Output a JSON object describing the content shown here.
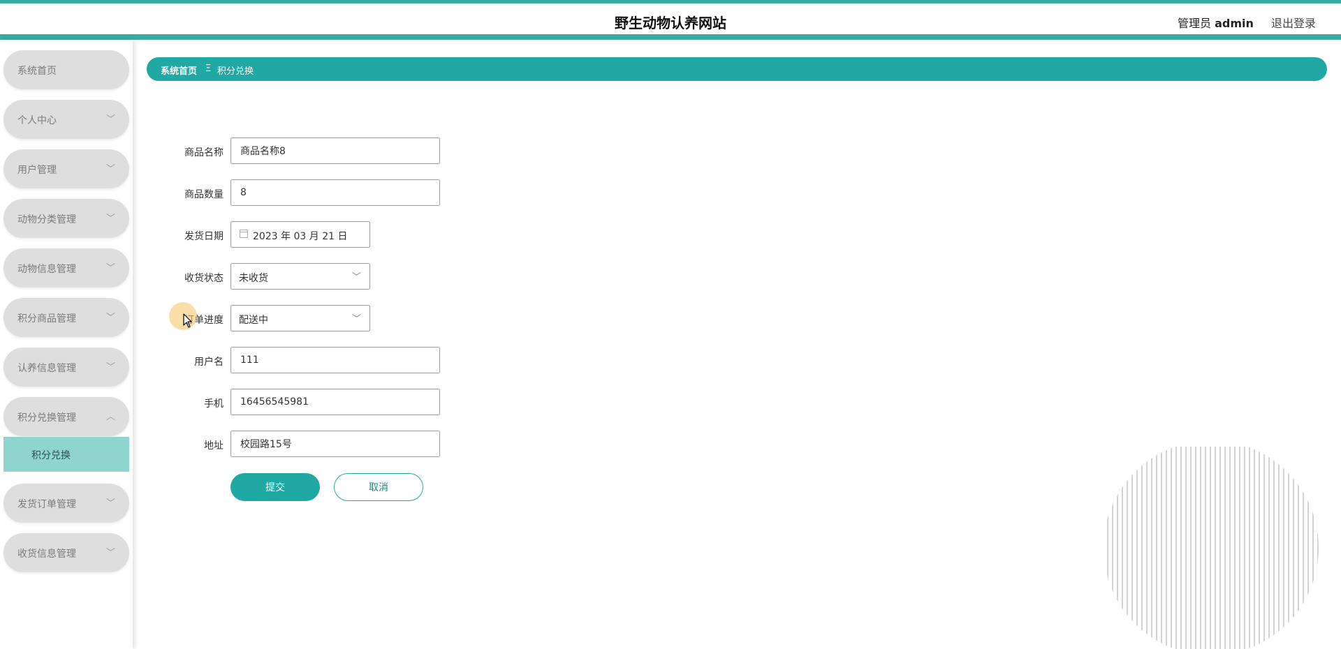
{
  "header": {
    "site_title": "野生动物认养网站",
    "user_role": "管理员",
    "user_name": "admin",
    "logout": "退出登录"
  },
  "sidebar": {
    "items": [
      {
        "label": "系统首页",
        "chevron": ""
      },
      {
        "label": "个人中心",
        "chevron": "chevron-down"
      },
      {
        "label": "用户管理",
        "chevron": "chevron-down"
      },
      {
        "label": "动物分类管理",
        "chevron": "chevron-down"
      },
      {
        "label": "动物信息管理",
        "chevron": "chevron-down"
      },
      {
        "label": "积分商品管理",
        "chevron": "chevron-down"
      },
      {
        "label": "认养信息管理",
        "chevron": "chevron-down"
      },
      {
        "label": "积分兑换管理",
        "chevron": "chevron-up"
      },
      {
        "label": "发货订单管理",
        "chevron": "chevron-down"
      },
      {
        "label": "收货信息管理",
        "chevron": "chevron-down"
      }
    ],
    "active_sub": "积分兑换"
  },
  "breadcrumb": {
    "home": "系统首页",
    "separator": "Ξ",
    "current": "积分兑换"
  },
  "form": {
    "product_name": {
      "label": "商品名称",
      "value": "商品名称8"
    },
    "quantity": {
      "label": "商品数量",
      "value": "8"
    },
    "ship_date": {
      "label": "发货日期",
      "value": "2023 年 03 月 21 日"
    },
    "receive_status": {
      "label": "收货状态",
      "value": "未收货"
    },
    "order_progress": {
      "label": "订单进度",
      "value": "配送中"
    },
    "username": {
      "label": "用户名",
      "value": "111"
    },
    "phone": {
      "label": "手机",
      "value": "16456545981"
    },
    "address": {
      "label": "地址",
      "value": "校园路15号"
    }
  },
  "buttons": {
    "submit": "提交",
    "cancel": "取消"
  },
  "colors": {
    "accent": "#1fa9a2",
    "stripe": "#3aaba4",
    "sidebar_item": "#dedede",
    "sidebar_active": "#8fd4cf"
  }
}
